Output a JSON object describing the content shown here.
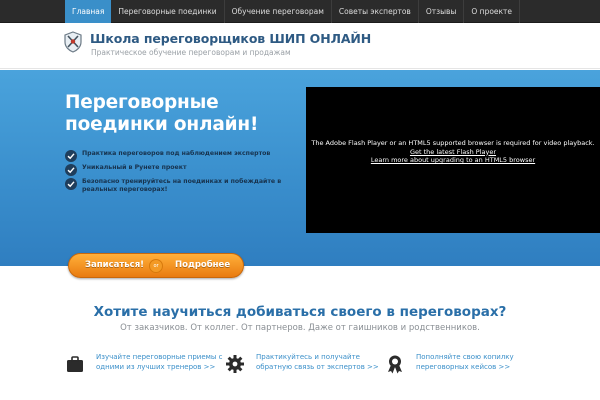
{
  "nav": {
    "items": [
      {
        "label": "Главная",
        "active": true
      },
      {
        "label": "Переговорные поединки",
        "active": false
      },
      {
        "label": "Обучение переговорам",
        "active": false
      },
      {
        "label": "Советы экспертов",
        "active": false
      },
      {
        "label": "Отзывы",
        "active": false
      },
      {
        "label": "О проекте",
        "active": false
      }
    ]
  },
  "header": {
    "logo_icon": "shield-swords-icon",
    "title": "Школа переговорщиков ШИП ОНЛАЙН",
    "subtitle": "Практическое обучение переговорам и продажам"
  },
  "hero": {
    "title": "Переговорные поединки онлайн!",
    "features": [
      "Практика переговоров под наблюдением экспертов",
      "Уникальный в Рунете проект",
      "Безопасно тренируйтесь на поединках и побеждайте в реальных переговорах!"
    ],
    "video": {
      "message": "The Adobe Flash Player or an HTML5 supported browser is required for video playback.",
      "link1": "Get the latest Flash Player",
      "link2": "Learn more about upgrading to an HTML5 browser"
    }
  },
  "cta": {
    "left_label": "Записаться!",
    "or_label": "or",
    "right_label": "Подробнее"
  },
  "section": {
    "title": "Хотите научиться добиваться своего в переговорах?",
    "subtitle": "От заказчиков. От коллег. От партнеров. Даже от гаишников и родственников."
  },
  "columns": [
    {
      "icon": "briefcase-icon",
      "text": "Изучайте переговорные приемы с одними из лучших тренеров >>"
    },
    {
      "icon": "gear-icon",
      "text": "Практикуйтесь и получайте обратную связь от экспертов >>"
    },
    {
      "icon": "award-icon",
      "text": "Пополняйте свою копилку переговорных кейсов >>"
    }
  ],
  "colors": {
    "accent": "#3a8fc9",
    "nav_bg": "#2b2b2b",
    "cta_orange": "#f39a25",
    "title_blue": "#2a6fa8"
  }
}
